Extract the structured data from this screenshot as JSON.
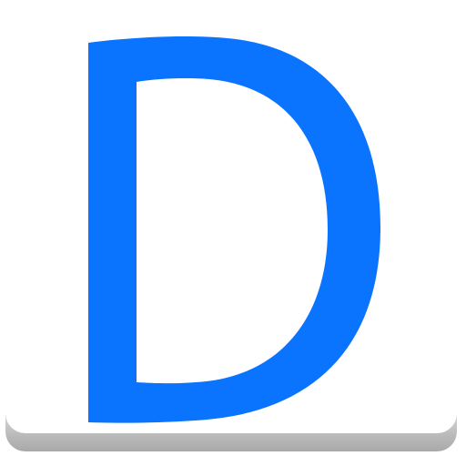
{
  "icon": {
    "letter": "D",
    "letter_color": "#0a74ff",
    "background_color": "#ffffff",
    "shadow_color": "#b0b0b0"
  }
}
